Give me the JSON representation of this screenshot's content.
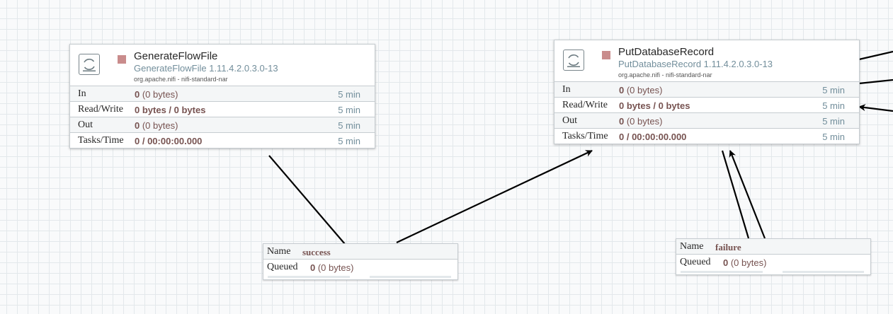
{
  "processors": [
    {
      "name": "GenerateFlowFile",
      "type": "GenerateFlowFile 1.11.4.2.0.3.0-13",
      "bundle": "org.apache.nifi - nifi-standard-nar",
      "run_status_color": "#c98c8c",
      "stats": [
        {
          "label": "In",
          "value_bold": "0",
          "value_rest": " (0 bytes)",
          "time": "5 min"
        },
        {
          "label": "Read/Write",
          "value_bold": "0 bytes / 0 bytes",
          "value_rest": "",
          "time": "5 min"
        },
        {
          "label": "Out",
          "value_bold": "0",
          "value_rest": " (0 bytes)",
          "time": "5 min"
        },
        {
          "label": "Tasks/Time",
          "value_bold": "0 / 00:00:00.000",
          "value_rest": "",
          "time": "5 min"
        }
      ]
    },
    {
      "name": "PutDatabaseRecord",
      "type": "PutDatabaseRecord 1.11.4.2.0.3.0-13",
      "bundle": "org.apache.nifi - nifi-standard-nar",
      "run_status_color": "#c98c8c",
      "stats": [
        {
          "label": "In",
          "value_bold": "0",
          "value_rest": " (0 bytes)",
          "time": "5 min"
        },
        {
          "label": "Read/Write",
          "value_bold": "0 bytes / 0 bytes",
          "value_rest": "",
          "time": "5 min"
        },
        {
          "label": "Out",
          "value_bold": "0",
          "value_rest": " (0 bytes)",
          "time": "5 min"
        },
        {
          "label": "Tasks/Time",
          "value_bold": "0 / 00:00:00.000",
          "value_rest": "",
          "time": "5 min"
        }
      ]
    }
  ],
  "connections": [
    {
      "name_key": "Name",
      "name": "success",
      "queued_key": "Queued",
      "queued_bold": "0",
      "queued_rest": " (0 bytes)"
    },
    {
      "name_key": "Name",
      "name": "failure",
      "queued_key": "Queued",
      "queued_bold": "0",
      "queued_rest": " (0 bytes)"
    }
  ],
  "colors": {
    "canvas_bg": "#f9fafb",
    "grid": "#e3e8eb",
    "value_text": "#775351",
    "type_text": "#728e9b",
    "border": "#c6ccd0"
  },
  "icons": {
    "processor": "processor-icon",
    "run_status": "stopped-icon"
  }
}
